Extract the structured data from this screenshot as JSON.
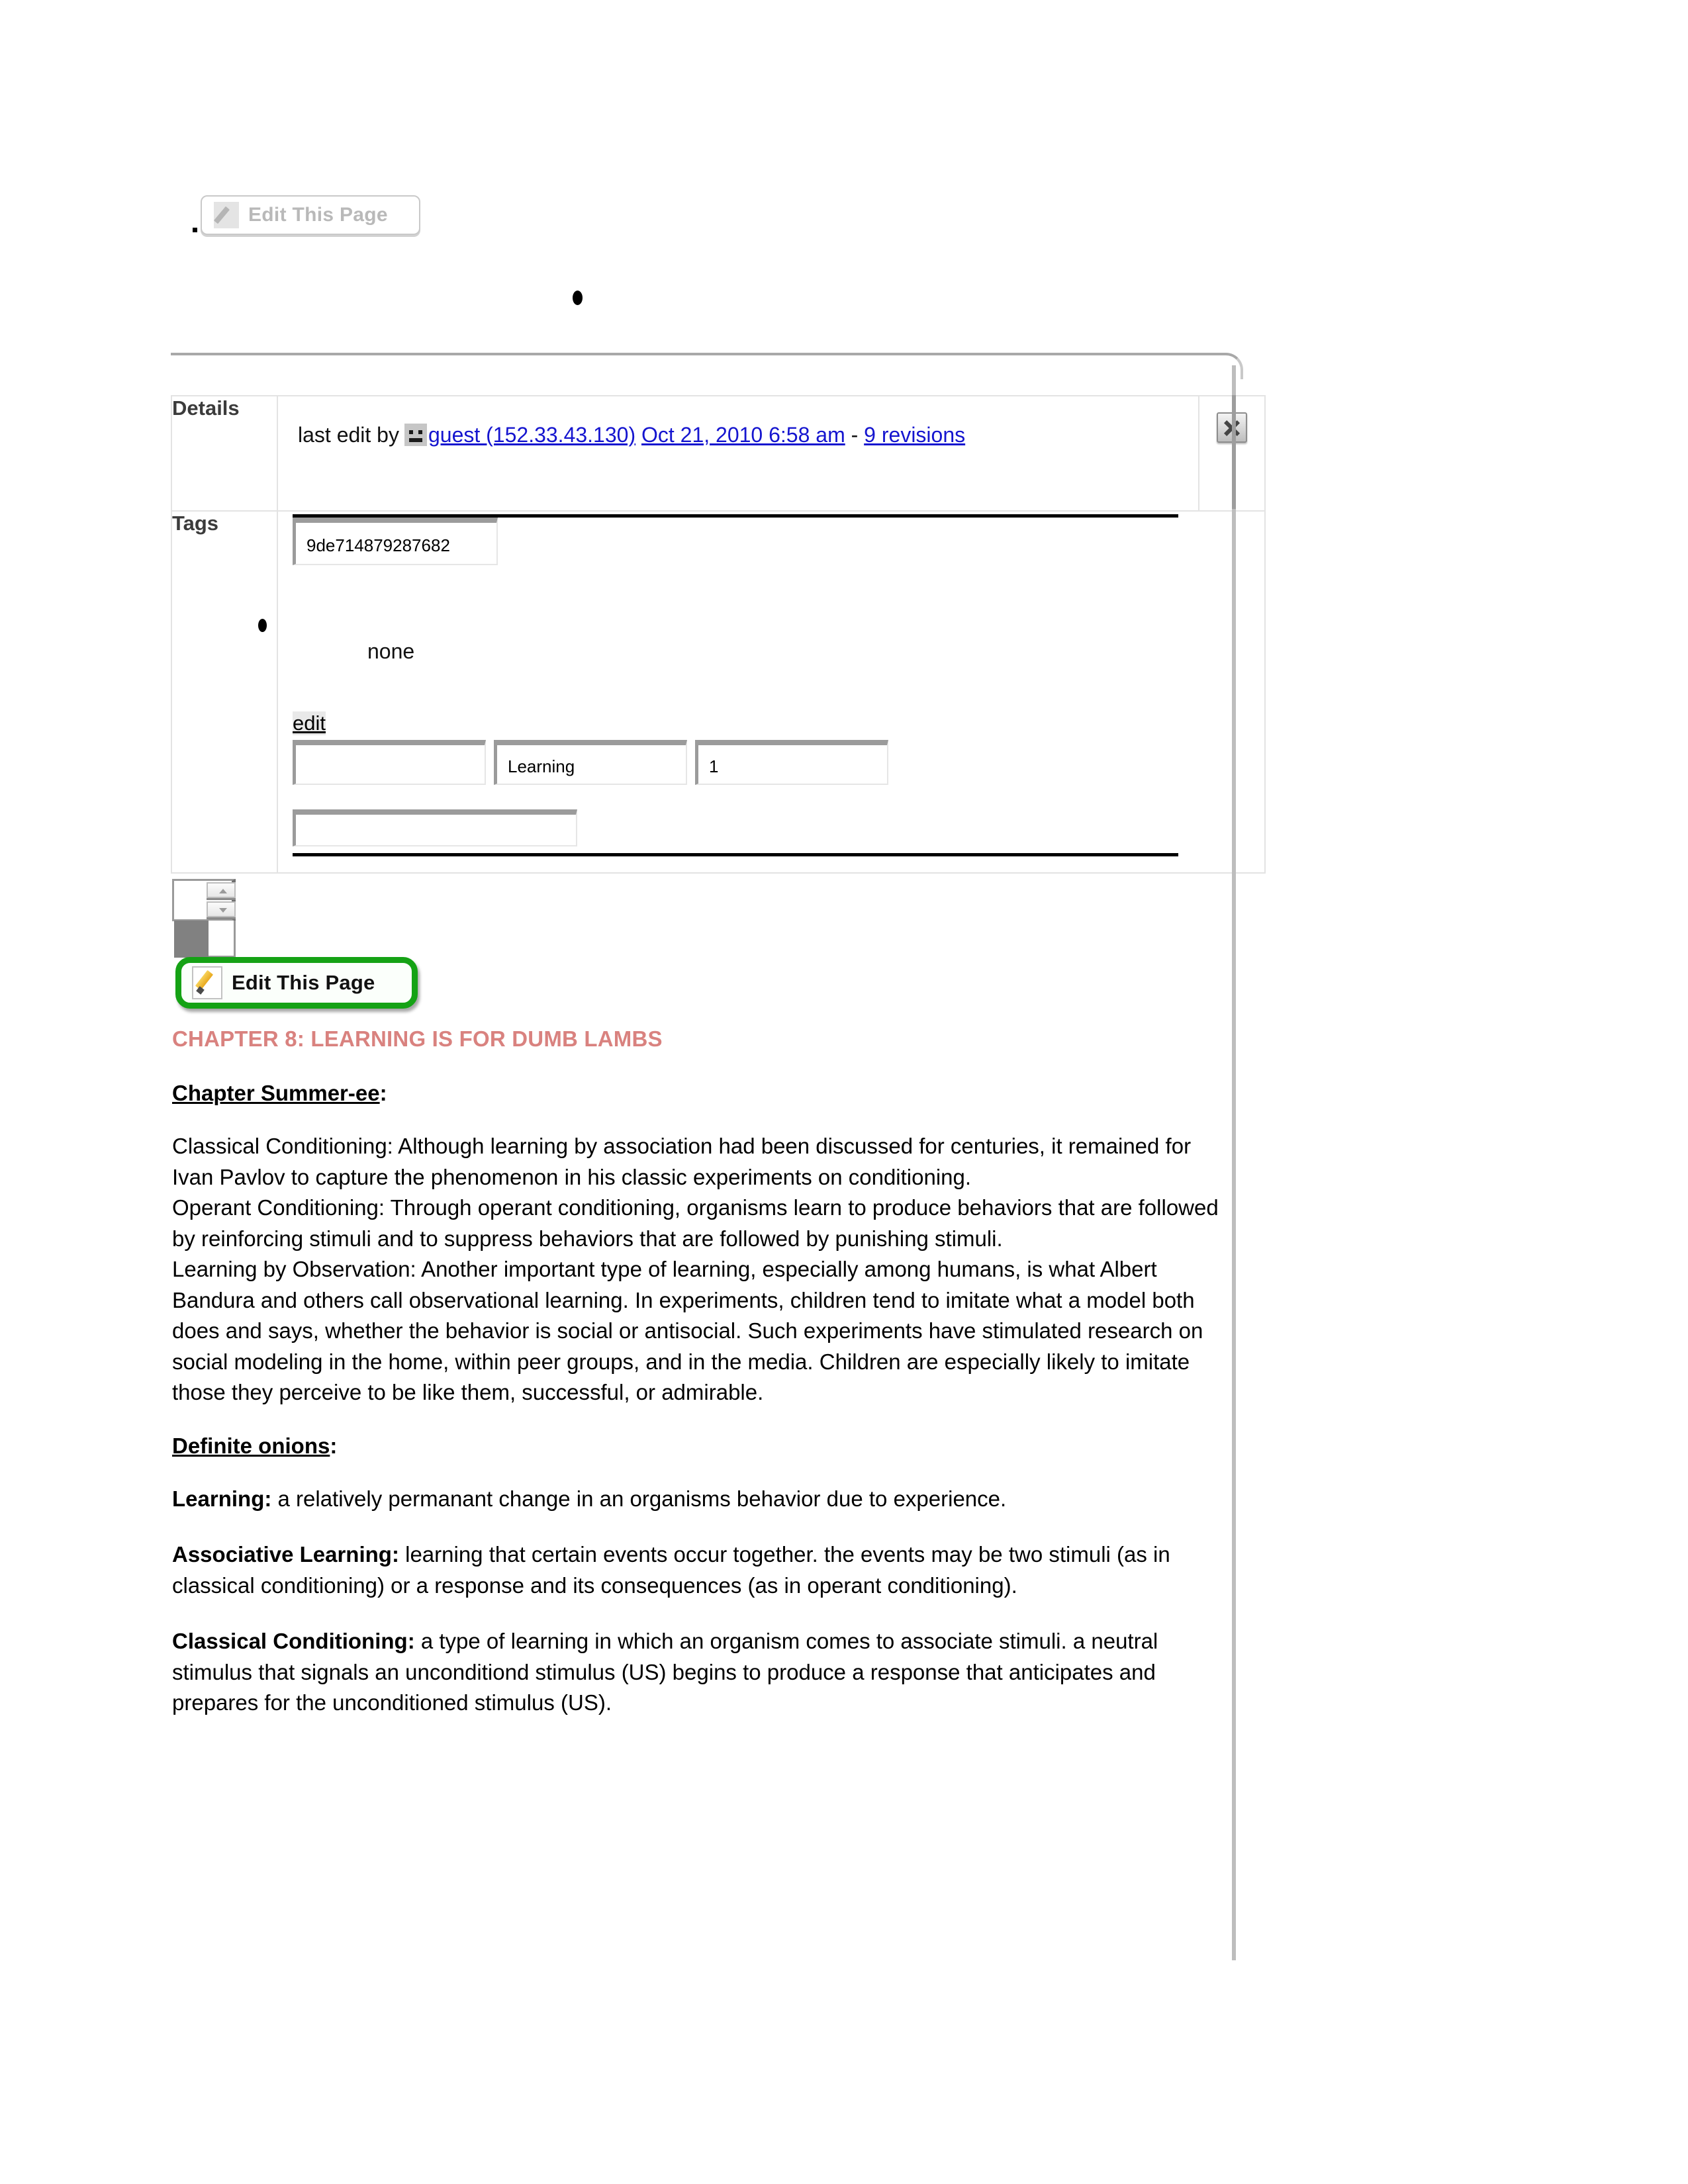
{
  "top_toolbar": {
    "edit_button_label": "Edit This Page",
    "edit_button_state": "disabled",
    "pencil_icon": "pencil-icon"
  },
  "details_panel": {
    "details_label": "Details",
    "last_edit_prefix": "last edit by",
    "avatar_icon": "guest-avatar-icon",
    "author_link": "guest (152.33.43.130)",
    "timestamp_link": "Oct 21, 2010 6:58 am",
    "separator": "-",
    "revisions_link": "9 revisions",
    "close_icon": "close-x-icon",
    "link_color": "#1515cf"
  },
  "tags_panel": {
    "tags_label": "Tags",
    "page_id_value": "9de714879287682",
    "none_text": "none",
    "edit_link": "edit",
    "field_blank_1": "",
    "field_tag_name": "Learning",
    "field_tag_count": "1",
    "field_blank_2": ""
  },
  "spinner": {
    "up_arrow_icon": "caret-up-icon",
    "down_arrow_icon": "caret-down-icon"
  },
  "edit_page_button": {
    "label": "Edit This Page",
    "pencil_icon": "pencil-icon",
    "border_color": "#15a215"
  },
  "article": {
    "chapter_title": "CHAPTER 8: LEARNING IS FOR DUMB LAMBS",
    "chapter_title_color": "#d9827f",
    "summary_heading": "Chapter Summer-ee",
    "summary_heading_colon": ":",
    "summary_paragraph": "Classical Conditioning: Although learning by association had been discussed for centuries, it remained for Ivan Pavlov to capture the phenomenon in his classic experiments on conditioning.\nOperant Conditioning: Through operant conditioning, organisms learn to produce behaviors that are followed by reinforcing stimuli and to suppress behaviors that are followed by punishing stimuli.\nLearning by Observation: Another important type of learning, especially among humans, is what Albert Bandura and others call observational learning. In experiments, children tend to imitate what a model both does and says, whether the behavior is social or antisocial. Such experiments have stimulated research on social modeling in the home, within peer groups, and in the media. Children are especially likely to imitate those they perceive to be like them, successful, or admirable.",
    "definitions_heading": "Definite onions",
    "definitions_heading_colon": ":",
    "definitions": [
      {
        "term": "Learning:",
        "text": " a relatively permanant change in an organisms behavior due to experience."
      },
      {
        "term": "Associative Learning:",
        "text": " learning that certain events occur together. the events may be two stimuli (as in classical conditioning) or a response and its consequences (as in operant conditioning)."
      },
      {
        "term": "Classical Conditioning:",
        "text": " a type of learning in which an organism comes to associate stimuli. a neutral stimulus that signals an unconditiond stimulus (US) begins to produce a response that anticipates and prepares for the unconditioned stimulus (US)."
      }
    ]
  }
}
